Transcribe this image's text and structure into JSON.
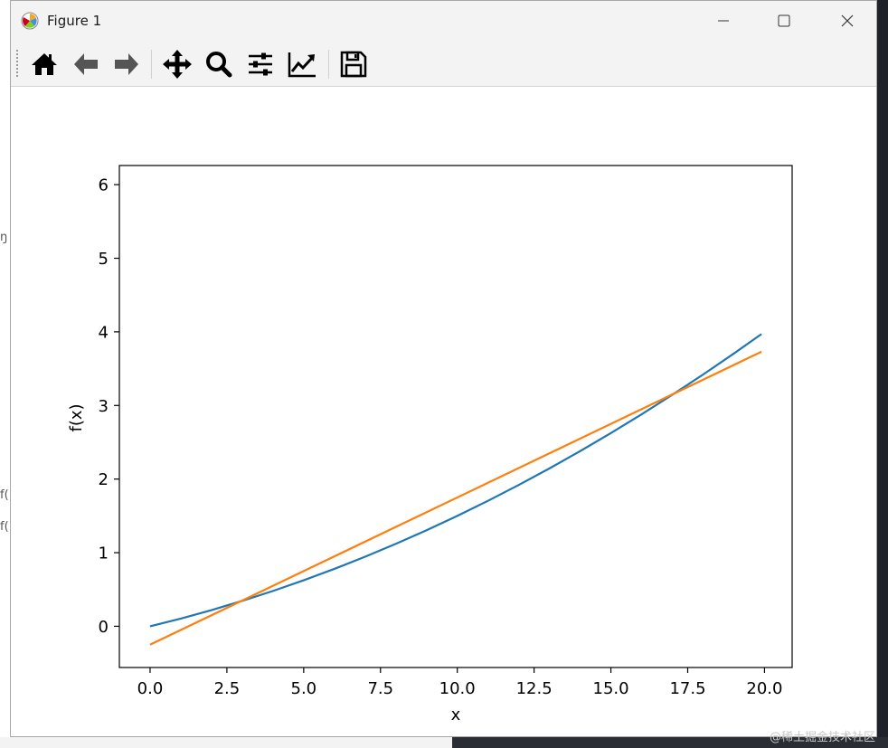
{
  "window": {
    "title": "Figure 1",
    "controls": {
      "minimize": "minimize",
      "maximize": "maximize",
      "close": "close"
    }
  },
  "toolbar": {
    "buttons": [
      {
        "name": "home",
        "icon": "home-icon"
      },
      {
        "name": "back",
        "icon": "arrow-left-icon"
      },
      {
        "name": "forward",
        "icon": "arrow-right-icon"
      },
      {
        "name": "pan",
        "icon": "move-icon"
      },
      {
        "name": "zoom",
        "icon": "magnifier-icon"
      },
      {
        "name": "configure-subplots",
        "icon": "sliders-icon"
      },
      {
        "name": "edit-axes",
        "icon": "line-chart-icon"
      },
      {
        "name": "save",
        "icon": "floppy-disk-icon"
      }
    ]
  },
  "chart_data": {
    "type": "line",
    "title": "",
    "xlabel": "x",
    "ylabel": "f(x)",
    "xlim": [
      -1,
      20.9
    ],
    "ylim": [
      -0.56,
      6.26
    ],
    "xticks": [
      "0.0",
      "2.5",
      "5.0",
      "7.5",
      "10.0",
      "12.5",
      "15.0",
      "17.5",
      "20.0"
    ],
    "yticks": [
      "0",
      "1",
      "2",
      "3",
      "4",
      "5",
      "6"
    ],
    "grid": false,
    "series": [
      {
        "color": "#1f77b4",
        "x": [
          0,
          1,
          2,
          3,
          4,
          5,
          6,
          7,
          8,
          9,
          10,
          11,
          12,
          13,
          14,
          15,
          16,
          17,
          18,
          19,
          19.9
        ],
        "y": [
          0,
          0.105,
          0.22,
          0.345,
          0.48,
          0.625,
          0.78,
          0.945,
          1.12,
          1.305,
          1.5,
          1.705,
          1.92,
          2.145,
          2.38,
          2.625,
          2.88,
          3.145,
          3.42,
          3.705,
          3.97
        ]
      },
      {
        "color": "#ff7f0e",
        "x": [
          0,
          19.9
        ],
        "y": [
          -0.25,
          3.73
        ]
      }
    ]
  }
}
